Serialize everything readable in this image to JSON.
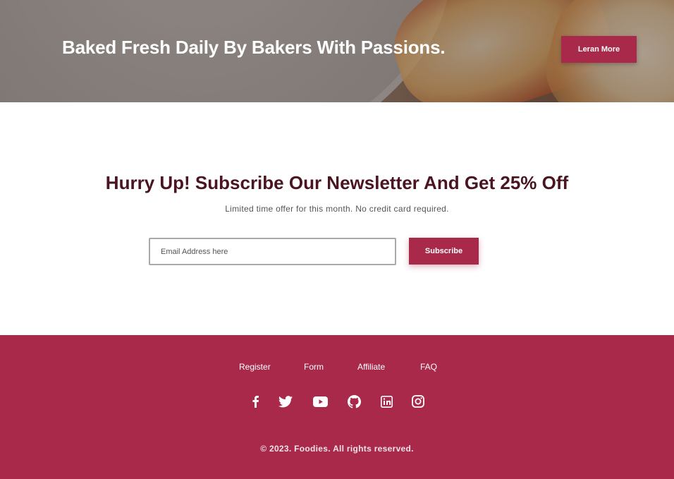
{
  "hero": {
    "title": "Baked Fresh Daily By Bakers With Passions.",
    "button_label": "Leran More"
  },
  "newsletter": {
    "title": "Hurry Up! Subscribe Our Newsletter And Get 25% Off",
    "subtitle": "Limited time offer for this month. No credit card required.",
    "email_placeholder": "Email Address here",
    "email_value": "",
    "button_label": "Subscribe"
  },
  "footer": {
    "links": [
      "Register",
      "Form",
      "Affiliate",
      "FAQ"
    ],
    "social_icons": [
      "facebook-icon",
      "twitter-icon",
      "youtube-icon",
      "github-icon",
      "linkedin-icon",
      "instagram-icon"
    ],
    "copyright": "© 2023. Foodies. All rights reserved."
  },
  "colors": {
    "brand": "#a8294a",
    "title_dark": "#4a1420"
  }
}
